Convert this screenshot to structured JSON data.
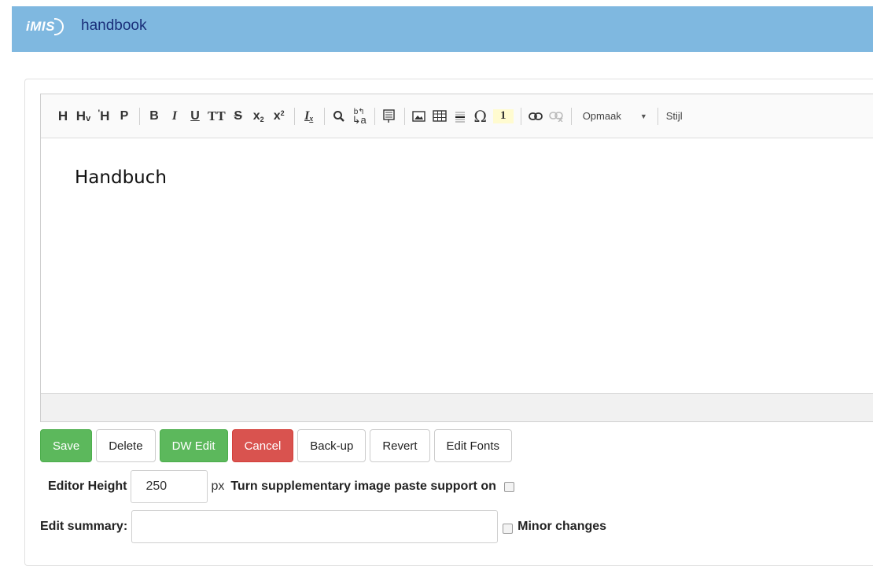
{
  "header": {
    "logo_text": "iMIS",
    "brand": "handbook"
  },
  "toolbar": {
    "items": [
      {
        "icon": "heading-1-icon",
        "glyph": "H"
      },
      {
        "icon": "heading-2-icon",
        "glyph": "Hᵥ"
      },
      {
        "icon": "heading-3-icon",
        "glyph": "ʼH"
      },
      {
        "icon": "paragraph-icon",
        "glyph": "P"
      },
      {
        "icon": "bold-icon",
        "glyph": "B"
      },
      {
        "icon": "italic-icon",
        "glyph": "I"
      },
      {
        "icon": "underline-icon",
        "glyph": "U"
      },
      {
        "icon": "small-caps-icon",
        "glyph": "TT"
      },
      {
        "icon": "strikethrough-icon",
        "glyph": "S"
      },
      {
        "icon": "subscript-icon",
        "glyph": "x₂"
      },
      {
        "icon": "superscript-icon",
        "glyph": "x²"
      },
      {
        "icon": "remove-format-icon",
        "glyph": "Iₓ"
      },
      {
        "icon": "find-icon",
        "glyph": "⚲"
      },
      {
        "icon": "replace-icon",
        "glyph": "b→a"
      },
      {
        "icon": "template-icon",
        "glyph": "☰"
      },
      {
        "icon": "image-icon",
        "glyph": "▣"
      },
      {
        "icon": "table-icon",
        "glyph": "⊞"
      },
      {
        "icon": "horizontal-rule-icon",
        "glyph": "≡"
      },
      {
        "icon": "special-char-icon",
        "glyph": "Ω"
      },
      {
        "icon": "footnote-icon",
        "glyph": "1"
      },
      {
        "icon": "link-icon",
        "glyph": "∞"
      },
      {
        "icon": "unlink-icon",
        "glyph": "∞"
      }
    ],
    "format_combo": "Opmaak",
    "style_combo": "Stijl"
  },
  "editor": {
    "content_text": "Handbuch"
  },
  "buttons": {
    "save": "Save",
    "delete": "Delete",
    "dw_edit": "DW Edit",
    "cancel": "Cancel",
    "backup": "Back-up",
    "revert": "Revert",
    "edit_fonts": "Edit Fonts"
  },
  "form": {
    "editor_height_label": "Editor Height",
    "editor_height_value": "250",
    "px_label": "px",
    "image_paste_label": "Turn supplementary image paste support on",
    "edit_summary_label": "Edit summary:",
    "edit_summary_value": "",
    "minor_changes_label": "Minor changes"
  },
  "colors": {
    "header_bg": "#7fb8e0",
    "brand_text": "#1a2f7a",
    "green": "#5cb85c",
    "red": "#d9534f"
  }
}
